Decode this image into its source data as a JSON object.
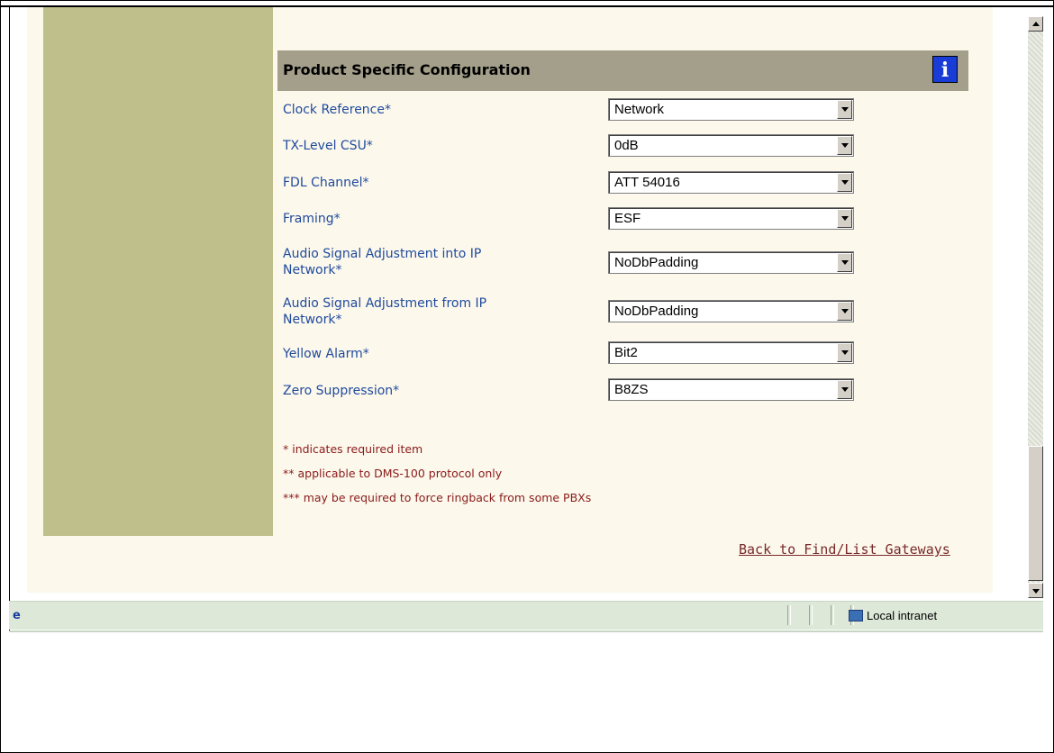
{
  "section": {
    "title": "Product Specific Configuration",
    "info_icon_glyph": "i"
  },
  "fields": [
    {
      "label": "Clock Reference*",
      "value": "Network"
    },
    {
      "label": "TX-Level CSU*",
      "value": "0dB"
    },
    {
      "label": "FDL Channel*",
      "value": "ATT 54016"
    },
    {
      "label": "Framing*",
      "value": "ESF"
    },
    {
      "label": "Audio Signal Adjustment into IP",
      "label2": "Network*",
      "value": "NoDbPadding"
    },
    {
      "label": "Audio Signal Adjustment from IP",
      "label2": "Network*",
      "value": "NoDbPadding"
    },
    {
      "label": "Yellow Alarm*",
      "value": "Bit2"
    },
    {
      "label": "Zero Suppression*",
      "value": "B8ZS"
    }
  ],
  "notes": [
    "* indicates required item",
    "** applicable to DMS-100 protocol only",
    "*** may be required to force ringback from some PBXs"
  ],
  "back_link": "Back to Find/List Gateways",
  "statusbar": {
    "zone": "Local intranet",
    "page_icon_glyph": "e"
  },
  "colors": {
    "sidebar": "#bfbf8c",
    "header": "#a39f8a",
    "label": "#1f4a9c",
    "note": "#8b1a1a"
  }
}
